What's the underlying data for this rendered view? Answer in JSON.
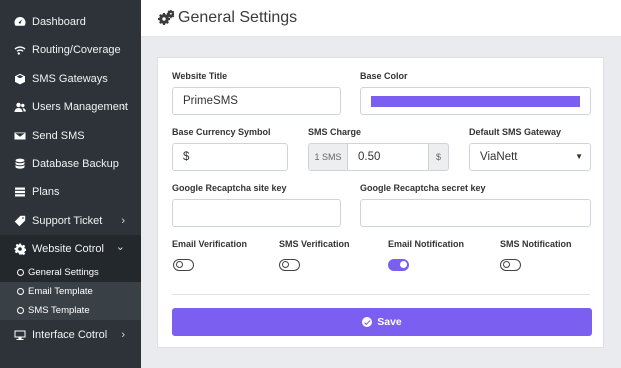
{
  "sidebar": {
    "items": [
      {
        "label": "Dashboard",
        "icon": "dashboard-icon"
      },
      {
        "label": "Routing/Coverage",
        "icon": "wifi-icon"
      },
      {
        "label": "SMS Gateways",
        "icon": "cube-icon"
      },
      {
        "label": "Users Management",
        "icon": "users-icon",
        "chevron": "›"
      },
      {
        "label": "Send SMS",
        "icon": "send-icon"
      },
      {
        "label": "Database Backup",
        "icon": "database-icon"
      },
      {
        "label": "Plans",
        "icon": "list-icon"
      },
      {
        "label": "Support Ticket",
        "icon": "ticket-icon",
        "chevron": "›"
      },
      {
        "label": "Website Cotrol",
        "icon": "gear-icon",
        "chevron": "⌄"
      },
      {
        "label": "Interface Cotrol",
        "icon": "monitor-icon",
        "chevron": "›"
      }
    ],
    "subitems": [
      {
        "label": "General Settings"
      },
      {
        "label": "Email Template"
      },
      {
        "label": "SMS Template"
      }
    ]
  },
  "header": {
    "title": "General Settings",
    "icon": "gears-icon"
  },
  "form": {
    "website_title": {
      "label": "Website Title",
      "value": "PrimeSMS"
    },
    "base_color": {
      "label": "Base Color",
      "value": "#7a5ff0"
    },
    "base_currency": {
      "label": "Base Currency Symbol",
      "value": "$"
    },
    "sms_charge": {
      "label": "SMS Charge",
      "prefix": "1 SMS",
      "value": "0.50",
      "suffix": "$"
    },
    "default_gateway": {
      "label": "Default SMS Gateway",
      "value": "ViaNett"
    },
    "recaptcha_site": {
      "label": "Google Recaptcha site key",
      "value": ""
    },
    "recaptcha_secret": {
      "label": "Google Recaptcha secret key",
      "value": ""
    },
    "toggles": [
      {
        "label": "Email Verification",
        "on": false
      },
      {
        "label": "SMS Verification",
        "on": false
      },
      {
        "label": "Email Notification",
        "on": true
      },
      {
        "label": "SMS Notification",
        "on": false
      }
    ],
    "save_label": "Save"
  },
  "colors": {
    "accent": "#7a5ff0",
    "sidebar": "#2d3338"
  }
}
